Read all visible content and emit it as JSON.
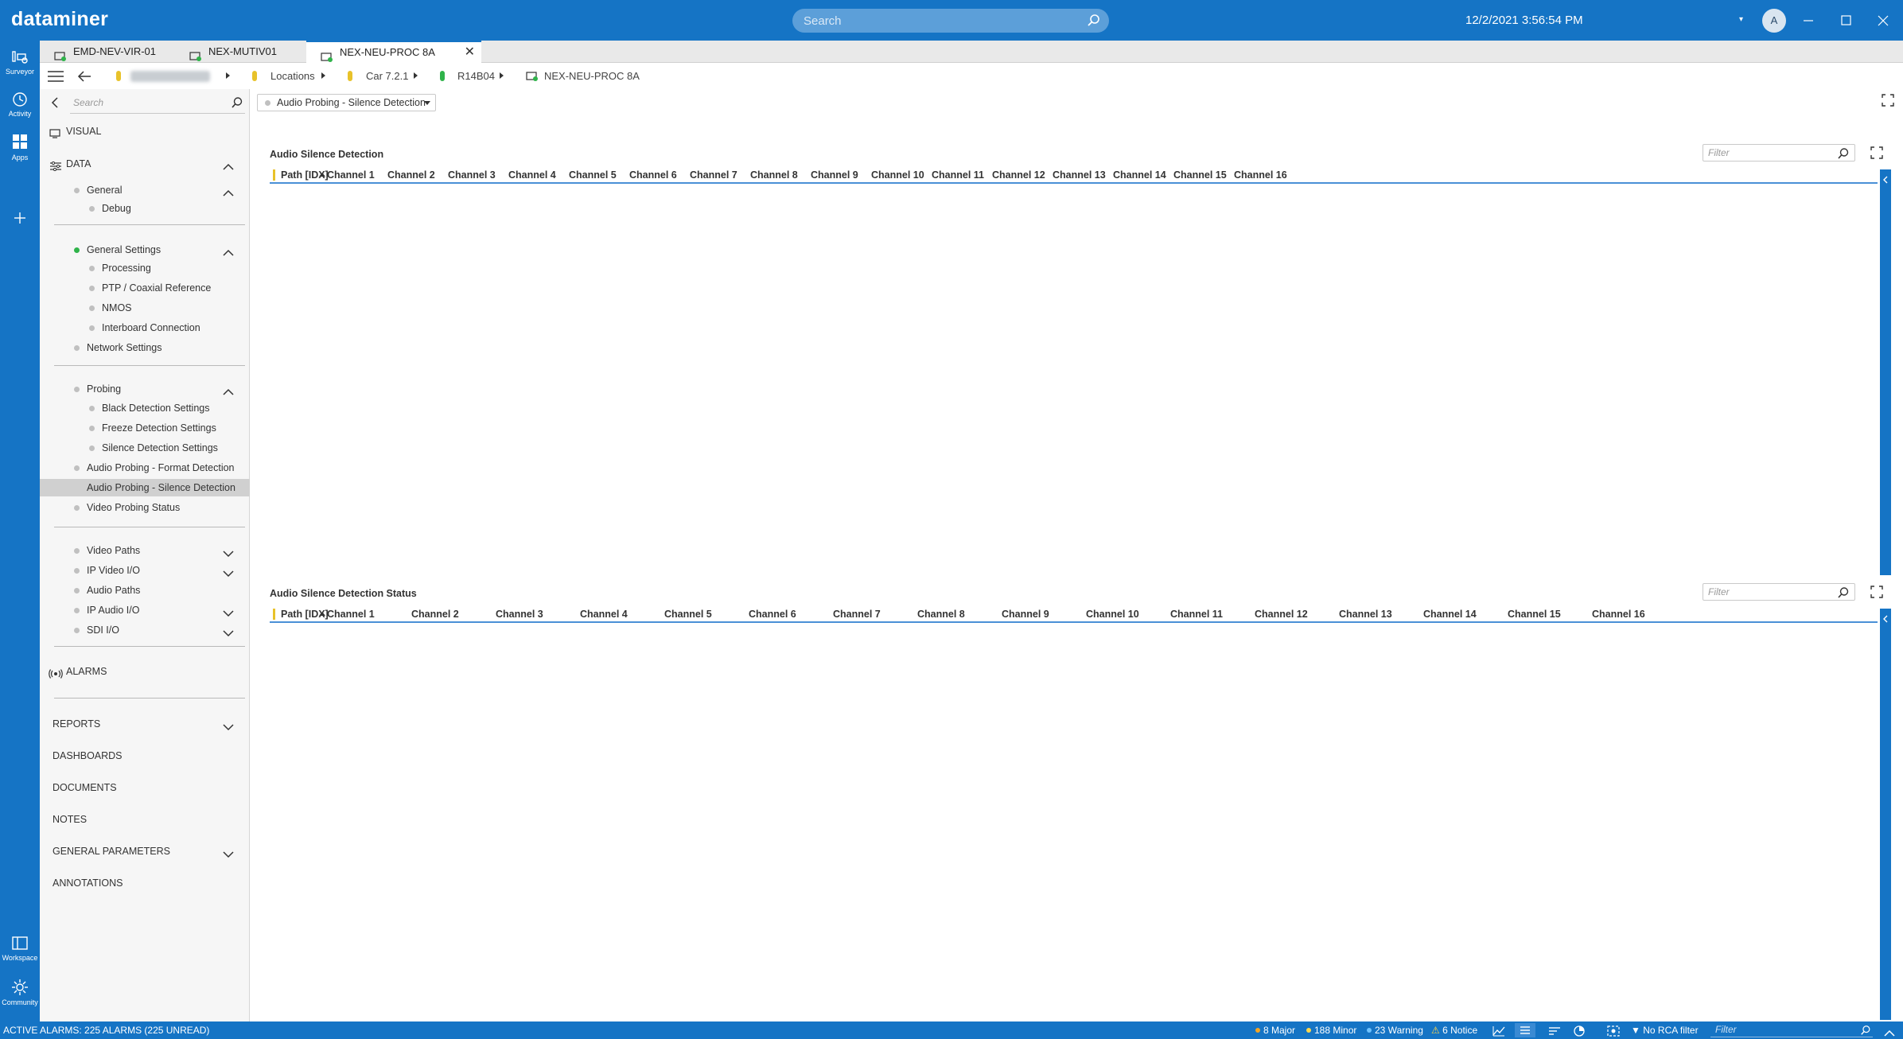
{
  "app": {
    "logo": "dataminer",
    "search_placeholder": "Search",
    "datetime": "12/2/2021 3:56:54 PM",
    "avatar_initial": "A"
  },
  "rail": {
    "surveyor": "Surveyor",
    "activity": "Activity",
    "apps": "Apps",
    "workspace": "Workspace",
    "community": "Community"
  },
  "tabs": [
    {
      "label": "EMD-NEV-VIR-01"
    },
    {
      "label": "NEX-MUTIV01"
    },
    {
      "label": "NEX-NEU-PROC 8A"
    }
  ],
  "breadcrumb": {
    "locations": "Locations",
    "car": "Car 7.2.1",
    "rack": "R14B04",
    "element": "NEX-NEU-PROC 8A"
  },
  "sidebar": {
    "search_placeholder": "Search",
    "visual": "VISUAL",
    "data": "DATA",
    "items": {
      "general": "General",
      "debug": "Debug",
      "general_settings": "General Settings",
      "processing": "Processing",
      "ptp": "PTP / Coaxial Reference",
      "nmos": "NMOS",
      "interboard": "Interboard Connection",
      "network_settings": "Network Settings",
      "probing": "Probing",
      "black_detection": "Black Detection Settings",
      "freeze_detection": "Freeze Detection Settings",
      "silence_detection": "Silence Detection Settings",
      "audio_format": "Audio Probing - Format Detection",
      "audio_silence": "Audio Probing - Silence Detection",
      "video_probing_status": "Video Probing Status",
      "video_paths": "Video Paths",
      "ip_video_io": "IP Video I/O",
      "audio_paths": "Audio Paths",
      "ip_audio_io": "IP Audio I/O",
      "sdi_io": "SDI I/O"
    },
    "alarms": "ALARMS",
    "sections": {
      "reports": "REPORTS",
      "dashboards": "DASHBOARDS",
      "documents": "DOCUMENTS",
      "notes": "NOTES",
      "general_parameters": "GENERAL PARAMETERS",
      "annotations": "ANNOTATIONS"
    }
  },
  "main": {
    "page_selector": "Audio Probing - Silence Detection",
    "table1": {
      "title": "Audio Silence Detection",
      "filter_placeholder": "Filter",
      "columns": [
        "Path [IDX]",
        "Channel 1",
        "Channel 2",
        "Channel 3",
        "Channel 4",
        "Channel 5",
        "Channel 6",
        "Channel 7",
        "Channel 8",
        "Channel 9",
        "Channel 10",
        "Channel 11",
        "Channel 12",
        "Channel 13",
        "Channel 14",
        "Channel 15",
        "Channel 16"
      ]
    },
    "table2": {
      "title": "Audio Silence Detection Status",
      "filter_placeholder": "Filter",
      "columns": [
        "Path [IDX]",
        "Channel 1",
        "Channel 2",
        "Channel 3",
        "Channel 4",
        "Channel 5",
        "Channel 6",
        "Channel 7",
        "Channel 8",
        "Channel 9",
        "Channel 10",
        "Channel 11",
        "Channel 12",
        "Channel 13",
        "Channel 14",
        "Channel 15",
        "Channel 16"
      ]
    }
  },
  "statusbar": {
    "active_alarms": "ACTIVE ALARMS: 225 ALARMS (225 UNREAD)",
    "major": "8 Major",
    "minor": "188 Minor",
    "warning": "23 Warning",
    "notice": "6 Notice",
    "rca": "No RCA filter",
    "filter_placeholder": "Filter"
  },
  "colors": {
    "brand": "#1574c5",
    "led_yellow": "#e8c22a",
    "led_green": "#2fb34a",
    "major": "#f5a623",
    "minor": "#ffd84d",
    "warning": "#6fc3ff"
  },
  "icons": [
    "search-icon",
    "surveyor-icon",
    "activity-icon",
    "apps-icon",
    "add-icon",
    "workspace-icon",
    "community-icon",
    "element-icon",
    "hamburger-icon",
    "back-arrow-icon",
    "fullscreen-icon",
    "chevron-up-icon",
    "chevron-down-icon",
    "visual-icon",
    "data-icon",
    "alarms-icon",
    "trend-icon",
    "filter-icon"
  ]
}
